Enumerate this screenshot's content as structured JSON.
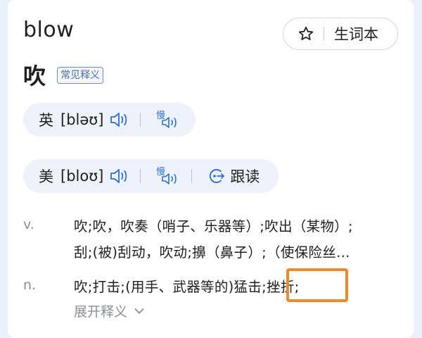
{
  "entry": {
    "headword": "blow",
    "main_translation": "吹",
    "common_tag": "常见释义"
  },
  "wordbook_button": {
    "label": "生词本",
    "icon": "star-icon"
  },
  "pronunciations": [
    {
      "region": "英",
      "ipa": "[bləʊ]",
      "speaker_icon": "speaker-icon",
      "slow_icon": "slow-speaker-icon"
    },
    {
      "region": "美",
      "ipa": "[bloʊ]",
      "speaker_icon": "speaker-icon",
      "slow_icon": "slow-speaker-icon",
      "follow_label": "跟读",
      "follow_icon": "follow-read-icon"
    }
  ],
  "definitions": [
    {
      "pos": "v.",
      "lines": [
        "吹;吹，吹奏（哨子、乐器等）;吹出（某物）;",
        "刮;(被)刮动，吹动;擤（鼻子）;（使保险丝…"
      ]
    },
    {
      "pos": "n.",
      "lines": [
        "吹;打击;(用手、武器等的)猛击;挫折;"
      ]
    }
  ],
  "expand_label": "展开释义",
  "colors": {
    "highlight_border": "#ef8a2c",
    "tag_blue": "#4f6fab",
    "pron_bg": "#eef3fb"
  }
}
